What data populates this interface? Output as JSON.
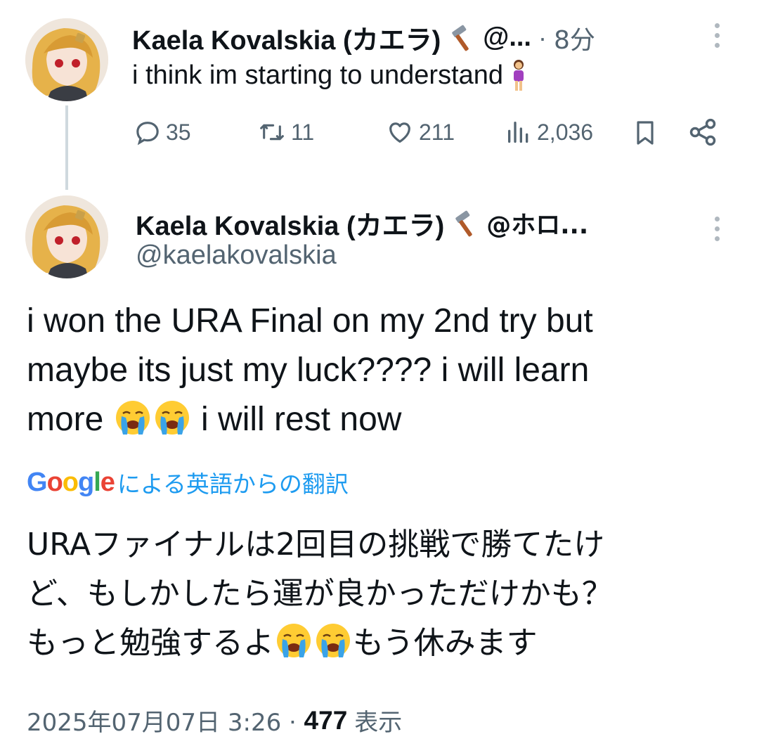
{
  "tweet1": {
    "author_name": "Kaela Kovalskia (カエラ)",
    "author_emoji": "🔨",
    "author_handle": "@...",
    "separator": "·",
    "time": "8分",
    "text": "i think im starting to understand",
    "text_emoji": "🧍‍♀️",
    "stats": {
      "replies": "35",
      "reposts": "11",
      "likes": "211",
      "views": "2,036"
    }
  },
  "tweet2": {
    "author_name": "Kaela Kovalskia (カエラ)",
    "author_emoji": "🔨",
    "author_handle_trunc": "@ホロ...",
    "handle": "@kaelakovalskia",
    "body_lines": [
      "i won the URA Final on my 2nd try but",
      "maybe its just my luck???? i will learn",
      "more",
      "i will rest now"
    ],
    "translation_provider": "Google",
    "translation_label": "による英語からの翻訳",
    "translated_lines": [
      "URAファイナルは2回目の挑戦で勝てたけ",
      "ど、もしかしたら運が良かっただけかも？",
      "もっと勉強するよ",
      "もう休みます"
    ],
    "timestamp": "2025年07月07日 3:26",
    "separator": "·",
    "views_count": "477",
    "views_label": "表示"
  },
  "colors": {
    "accent": "#1d9bf0",
    "muted": "#536471",
    "text": "#0f1419",
    "thread_line": "#cfd9de"
  },
  "icons": [
    "reply-icon",
    "repost-icon",
    "like-icon",
    "views-icon",
    "bookmark-icon",
    "share-icon",
    "more-icon",
    "hammer-emoji",
    "crying-emoji",
    "person-emoji"
  ]
}
